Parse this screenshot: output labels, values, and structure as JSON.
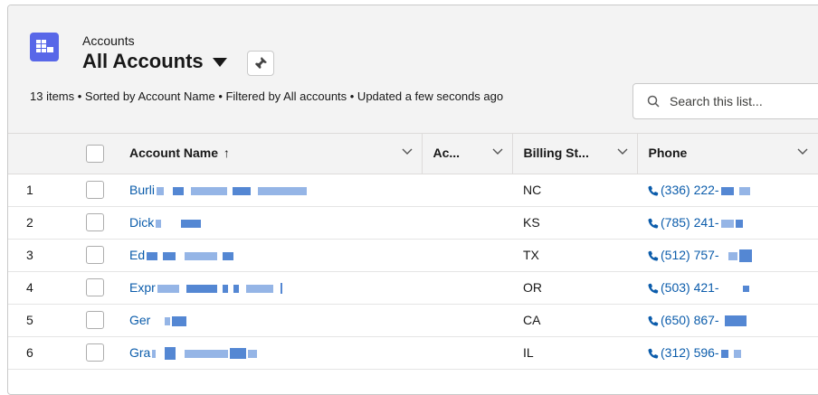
{
  "header": {
    "object_label": "Accounts",
    "list_view_name": "All Accounts",
    "meta_text": "13 items • Sorted by Account Name • Filtered by All accounts • Updated a few seconds ago"
  },
  "search": {
    "placeholder": "Search this list..."
  },
  "table": {
    "columns": [
      {
        "label": "Account Name"
      },
      {
        "label": "Ac..."
      },
      {
        "label": "Billing St..."
      },
      {
        "label": "Phone"
      }
    ],
    "rows": [
      {
        "num": "1",
        "name_prefix": "Burli",
        "state": "NC",
        "phone": "(336) 222-"
      },
      {
        "num": "2",
        "name_prefix": "Dick",
        "state": "KS",
        "phone": "(785) 241-"
      },
      {
        "num": "3",
        "name_prefix": "Ed",
        "state": "TX",
        "phone": "(512) 757-"
      },
      {
        "num": "4",
        "name_prefix": "Expr",
        "state": "OR",
        "phone": "(503) 421-"
      },
      {
        "num": "5",
        "name_prefix": "Ger",
        "state": "CA",
        "phone": "(650) 867-"
      },
      {
        "num": "6",
        "name_prefix": "Gra",
        "state": "IL",
        "phone": "(312) 596-"
      }
    ]
  },
  "icons": {
    "object": "table-grid-icon",
    "pin": "pin-icon",
    "search": "search-icon",
    "sort": "sort-up-arrow-icon",
    "phone": "phone-icon",
    "dropdown": "chevron-down-icon"
  },
  "colors": {
    "accent": "#5867e8",
    "link": "#0b5cab",
    "header_bg": "#f3f3f3"
  }
}
